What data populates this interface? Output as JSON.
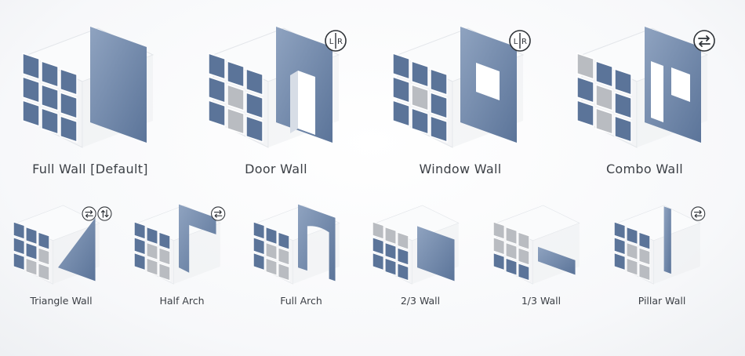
{
  "colors": {
    "accent": "#5b7499",
    "accent_light": "#8fa3c0",
    "grey_block": "#b9bcc1",
    "cube_face": "#f3f4f6",
    "text": "#3b3f45"
  },
  "top_row": [
    {
      "label": "Full Wall [Default]",
      "wall": "full",
      "greyed": [],
      "badges": []
    },
    {
      "label": "Door Wall",
      "wall": "door",
      "greyed": [
        4,
        7
      ],
      "badges": [
        {
          "type": "lr",
          "text_left": "L",
          "text_right": "R"
        }
      ]
    },
    {
      "label": "Window Wall",
      "wall": "window",
      "greyed": [
        4
      ],
      "badges": [
        {
          "type": "lr",
          "text_left": "L",
          "text_right": "R"
        }
      ]
    },
    {
      "label": "Combo Wall",
      "wall": "combo",
      "greyed": [
        0,
        4,
        7
      ],
      "badges": [
        {
          "type": "swap",
          "icon": "swap-horizontal-icon"
        }
      ]
    }
  ],
  "bottom_row": [
    {
      "label": "Triangle Wall",
      "wall": "triangle",
      "greyed": [
        5,
        7,
        8
      ],
      "badges": [
        {
          "type": "swap",
          "icon": "swap-horizontal-icon"
        },
        {
          "type": "flip",
          "icon": "swap-vertical-icon"
        }
      ]
    },
    {
      "label": "Half Arch",
      "wall": "halfarch",
      "greyed": [
        4,
        5,
        7,
        8
      ],
      "badges": [
        {
          "type": "swap",
          "icon": "swap-horizontal-icon"
        }
      ]
    },
    {
      "label": "Full Arch",
      "wall": "fullarch",
      "greyed": [
        4,
        5,
        7,
        8
      ],
      "badges": []
    },
    {
      "label": "2/3 Wall",
      "wall": "twothirds",
      "greyed": [
        0,
        1,
        2
      ],
      "badges": []
    },
    {
      "label": "1/3 Wall",
      "wall": "onethird",
      "greyed": [
        0,
        1,
        2,
        3,
        4,
        5
      ],
      "badges": []
    },
    {
      "label": "Pillar Wall",
      "wall": "pillar",
      "greyed": [
        4,
        5,
        7,
        8
      ],
      "badges": [
        {
          "type": "swap",
          "icon": "swap-horizontal-icon"
        }
      ]
    }
  ]
}
